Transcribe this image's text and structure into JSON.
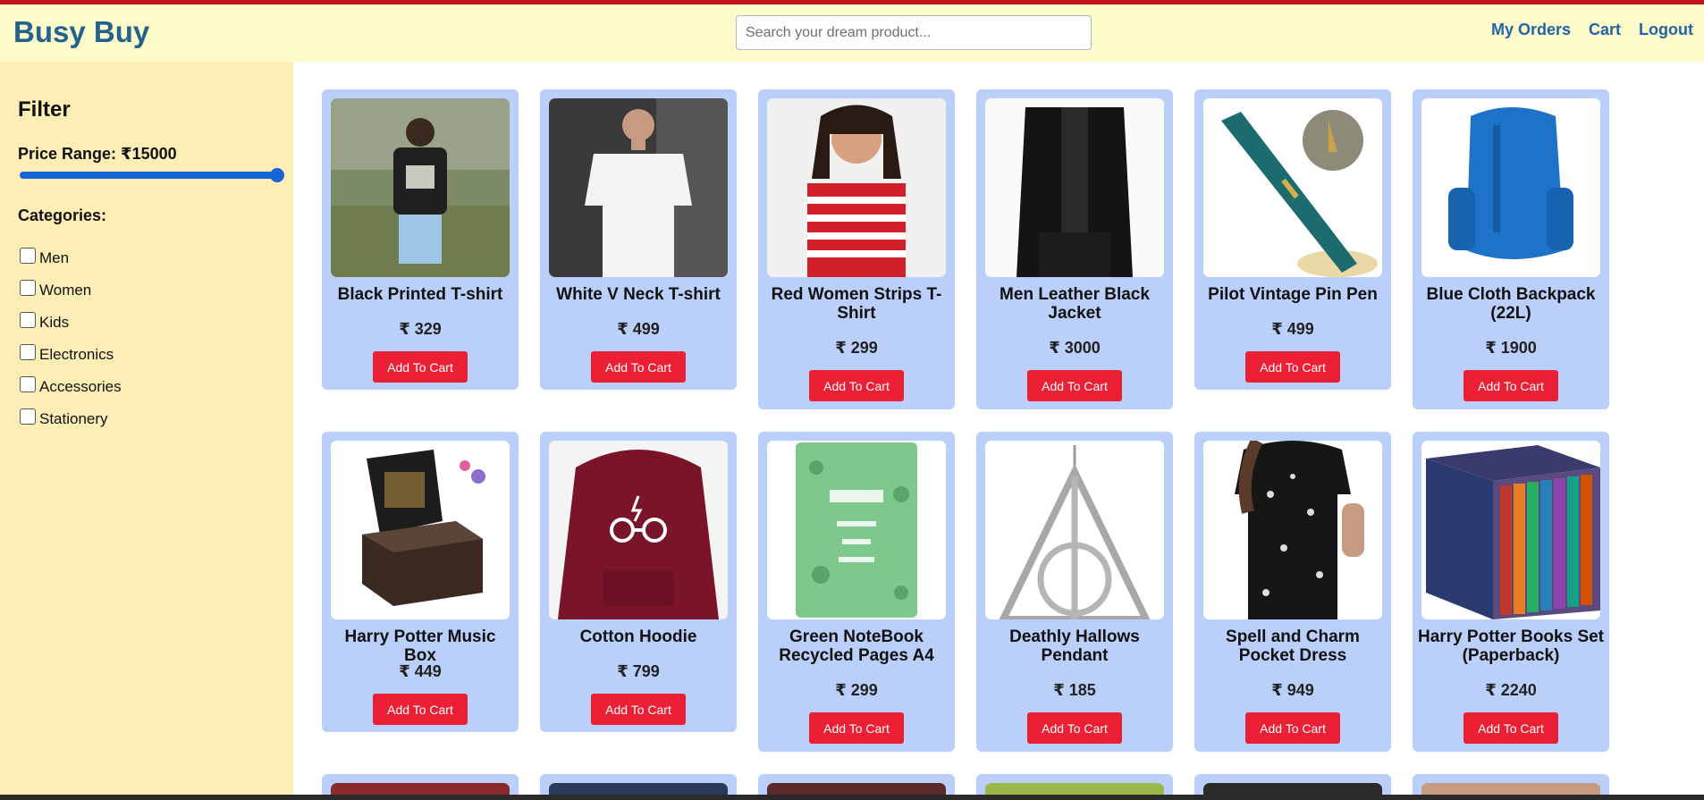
{
  "app": {
    "title": "Busy Buy"
  },
  "search": {
    "placeholder": "Search your dream product..."
  },
  "nav": {
    "orders": "My Orders",
    "cart": "Cart",
    "logout": "Logout"
  },
  "filter": {
    "title": "Filter",
    "price_label": "Price Range: ₹15000",
    "price_slider_fraction": 1.0,
    "categories_title": "Categories:",
    "categories": [
      {
        "label": "Men",
        "checked": false
      },
      {
        "label": "Women",
        "checked": false
      },
      {
        "label": "Kids",
        "checked": false
      },
      {
        "label": "Electronics",
        "checked": false
      },
      {
        "label": "Accessories",
        "checked": false
      },
      {
        "label": "Stationery",
        "checked": false
      }
    ]
  },
  "add_to_cart_label": "Add To Cart",
  "products": [
    {
      "name": "Black Printed T-shirt",
      "price": "₹ 329",
      "image": "black-tshirt-photo"
    },
    {
      "name": "White V Neck T-shirt",
      "price": "₹ 499",
      "image": "white-tshirt-photo"
    },
    {
      "name": "Red Women Strips T-Shirt",
      "price": "₹ 299",
      "image": "red-striped-tshirt-photo"
    },
    {
      "name": "Men Leather Black Jacket",
      "price": "₹ 3000",
      "image": "leather-jacket-photo"
    },
    {
      "name": "Pilot Vintage Pin Pen",
      "price": "₹ 499",
      "image": "fountain-pen-photo"
    },
    {
      "name": "Blue Cloth Backpack (22L)",
      "price": "₹ 1900",
      "image": "blue-backpack-photo"
    },
    {
      "name": "Harry Potter Music Box",
      "price": "₹ 449",
      "image": "music-box-photo"
    },
    {
      "name": "Cotton Hoodie",
      "price": "₹ 799",
      "image": "maroon-hoodie-photo"
    },
    {
      "name": "Green NoteBook Recycled Pages A4",
      "price": "₹ 299",
      "image": "green-notebook-photo"
    },
    {
      "name": "Deathly Hallows Pendant",
      "price": "₹ 185",
      "image": "pendant-photo"
    },
    {
      "name": "Spell and Charm Pocket Dress",
      "price": "₹ 949",
      "image": "black-dress-photo"
    },
    {
      "name": "Harry Potter Books Set (Paperback)",
      "price": "₹ 2240",
      "image": "book-set-photo"
    }
  ],
  "colors": {
    "brand": "#23628f",
    "nav_bg": "#fdfbca",
    "sidebar_bg": "#fdeeb5",
    "card_bg": "#bad0fb",
    "button": "#eb2034",
    "slider": "#1766d6"
  }
}
